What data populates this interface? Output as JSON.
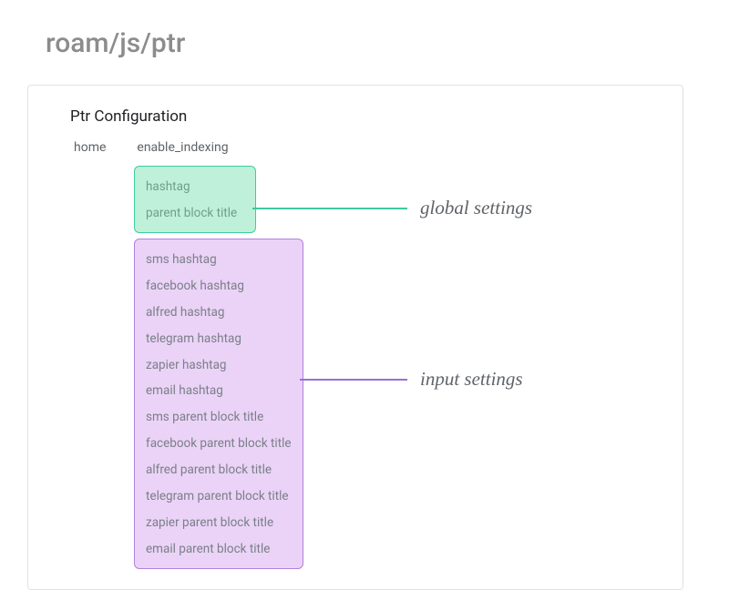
{
  "title": "roam/js/ptr",
  "panel": {
    "title": "Ptr Configuration",
    "tabs": [
      {
        "label": "home"
      },
      {
        "label": "enable_indexing"
      }
    ],
    "global_group": {
      "items": [
        "hashtag",
        "parent block title"
      ]
    },
    "input_group": {
      "items": [
        "sms hashtag",
        "facebook hashtag",
        "alfred hashtag",
        "telegram hashtag",
        "zapier hashtag",
        "email hashtag",
        "sms parent block title",
        "facebook parent block title",
        "alfred parent block title",
        "telegram parent block title",
        "zapier parent block title",
        "email parent block title"
      ]
    }
  },
  "annotations": {
    "global": "global settings",
    "input": "input settings"
  },
  "colors": {
    "global_border": "#3ccd9e",
    "global_fill": "#bff1da",
    "input_border": "#b27fe0",
    "input_fill": "#ebd3f8"
  }
}
